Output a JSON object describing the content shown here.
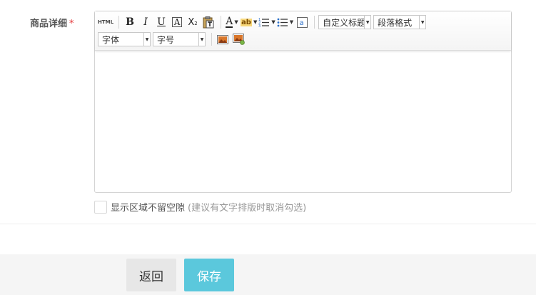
{
  "field": {
    "label": "商品详细",
    "required_mark": "*"
  },
  "toolbar": {
    "html_label": "HTML",
    "bold_label": "B",
    "italic_label": "I",
    "underline_label": "U",
    "font_border_label": "A",
    "subscript_label": "X",
    "subscript_small": "2",
    "font_color_label": "A",
    "highlight_label": "ab",
    "custom_title": {
      "value": "自定义标题"
    },
    "paragraph": {
      "value": "段落格式"
    },
    "font_family": {
      "value": "字体"
    },
    "font_size": {
      "value": "字号"
    }
  },
  "options": {
    "no_spacing_label": "显示区域不留空隙",
    "no_spacing_hint": "(建议有文字排版时取消勾选)",
    "no_spacing_checked": false
  },
  "footer": {
    "back_label": "返回",
    "save_label": "保存"
  },
  "colors": {
    "save_button": "#5bc8dc",
    "back_button": "#e7e7e7",
    "required": "#e4393c"
  }
}
